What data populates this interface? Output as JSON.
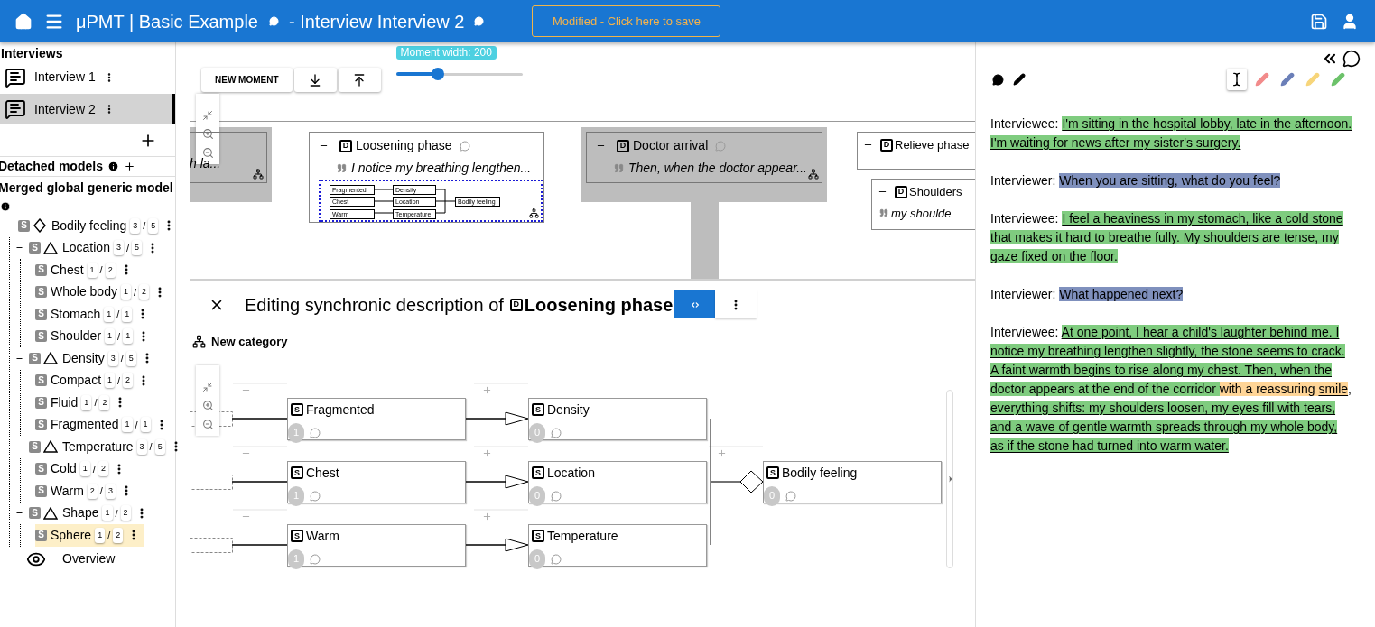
{
  "header": {
    "title": "μPMT | Basic Example",
    "interview_title": "- Interview Interview 2",
    "save_button": "Modified - Click here to save"
  },
  "sidebar": {
    "interviews_heading": "Interviews",
    "interviews": [
      {
        "label": "Interview 1",
        "selected": false
      },
      {
        "label": "Interview 2",
        "selected": true
      }
    ],
    "detached_heading": "Detached models",
    "merged_heading": "Merged global generic model",
    "tree": [
      {
        "badge": "S",
        "kind": "generic",
        "label": "Bodily feeling",
        "counts": [
          "3",
          "/",
          "5"
        ],
        "selected": false,
        "expanded": true,
        "children": [
          {
            "badge": "S",
            "kind": "category",
            "label": "Location",
            "counts": [
              "3",
              "/",
              "5"
            ],
            "selected": false,
            "expanded": true,
            "children": [
              {
                "badge": "S",
                "label": "Chest",
                "counts": [
                  "1",
                  "/",
                  "2"
                ],
                "selected": false
              },
              {
                "badge": "S",
                "label": "Whole body",
                "counts": [
                  "1",
                  "/",
                  "2"
                ],
                "selected": false
              },
              {
                "badge": "S",
                "label": "Stomach",
                "counts": [
                  "1",
                  "/",
                  "1"
                ],
                "selected": false
              },
              {
                "badge": "S",
                "label": "Shoulder",
                "counts": [
                  "1",
                  "/",
                  "1"
                ],
                "selected": false
              }
            ]
          },
          {
            "badge": "S",
            "kind": "category",
            "label": "Density",
            "counts": [
              "3",
              "/",
              "5"
            ],
            "selected": false,
            "expanded": true,
            "children": [
              {
                "badge": "S",
                "label": "Compact",
                "counts": [
                  "1",
                  "/",
                  "2"
                ],
                "selected": false
              },
              {
                "badge": "S",
                "label": "Fluid",
                "counts": [
                  "1",
                  "/",
                  "2"
                ],
                "selected": false
              },
              {
                "badge": "S",
                "label": "Fragmented",
                "counts": [
                  "1",
                  "/",
                  "1"
                ],
                "selected": false
              }
            ]
          },
          {
            "badge": "S",
            "kind": "category",
            "label": "Temperature",
            "counts": [
              "3",
              "/",
              "5"
            ],
            "selected": false,
            "expanded": true,
            "children": [
              {
                "badge": "S",
                "label": "Cold",
                "counts": [
                  "1",
                  "/",
                  "2"
                ],
                "selected": false
              },
              {
                "badge": "S",
                "label": "Warm",
                "counts": [
                  "2",
                  "/",
                  "3"
                ],
                "selected": false
              }
            ]
          },
          {
            "badge": "S",
            "kind": "category",
            "label": "Shape",
            "counts": [
              "1",
              "/",
              "2"
            ],
            "selected": false,
            "expanded": true,
            "children": [
              {
                "badge": "S",
                "label": "Sphere",
                "counts": [
                  "1",
                  "/",
                  "2"
                ],
                "selected": true
              }
            ]
          }
        ]
      }
    ],
    "overview": "Overview"
  },
  "toolbar": {
    "new_moment": "NEW MOMENT",
    "slider": {
      "label": "Moment width: 200",
      "level": 0.33
    }
  },
  "moments": [
    {
      "kind": "partial",
      "quote": "h la...",
      "highlighted": true
    },
    {
      "kind": "card",
      "badge": "D",
      "title": "Loosening phase",
      "quote": "I notice my breathing lengthen...",
      "highlighted": false,
      "mini_diagram": [
        [
          "Fragmented",
          "Chest",
          "Warm"
        ],
        [
          "Density",
          "Location",
          "Temperature"
        ],
        [
          "Bodily feeling"
        ]
      ]
    },
    {
      "kind": "card",
      "badge": "D",
      "title": "Doctor arrival",
      "quote": "Then, when the doctor appear...",
      "highlighted": true
    },
    {
      "kind": "nested",
      "badge": "D",
      "title": "Relieve phase",
      "highlighted": false,
      "children": [
        {
          "badge": "D",
          "title": "Shoulders",
          "quote": "my shoulde"
        }
      ]
    }
  ],
  "editor": {
    "title": "Editing synchronic description of",
    "badge": "D",
    "moment": "Loosening phase",
    "new_category": "New category",
    "columns": [
      {
        "kind": "source",
        "nodes": [
          {
            "badge": "S",
            "label": "Fragmented",
            "count": "1"
          },
          {
            "badge": "S",
            "label": "Chest",
            "count": "1"
          },
          {
            "badge": "S",
            "label": "Warm",
            "count": "1"
          }
        ]
      },
      {
        "kind": "specialization",
        "nodes": [
          {
            "badge": "S",
            "label": "Density",
            "count": "0"
          },
          {
            "badge": "S",
            "label": "Location",
            "count": "0"
          },
          {
            "badge": "S",
            "label": "Temperature",
            "count": "0"
          }
        ]
      },
      {
        "kind": "aggregation",
        "nodes": [
          {
            "badge": "S",
            "label": "Bodily feeling",
            "count": "0"
          }
        ]
      }
    ]
  },
  "highlight_tools": [
    {
      "kind": "cursor",
      "selected": true
    },
    {
      "kind": "pencil",
      "color": "#f28b8b",
      "selected": false
    },
    {
      "kind": "pencil",
      "color": "#6b7fb8",
      "selected": false
    },
    {
      "kind": "pencil",
      "color": "#f7d57a",
      "selected": false
    },
    {
      "kind": "pencil",
      "color": "#6cc26a",
      "selected": false
    }
  ],
  "transcript": [
    {
      "speaker": "Interviewee:",
      "segments": [
        {
          "text": "I'm sitting in the hospital lobby, late in the afternoon. I'm waiting for news after my sister's surgery.",
          "color": "#7fcc7f",
          "underline": true
        }
      ]
    },
    {
      "speaker": "Interviewer:",
      "segments": [
        {
          "text": "When you are sitting, what do you feel?",
          "color": "#7f90bd",
          "underline": false
        }
      ]
    },
    {
      "speaker": "Interviewee:",
      "segments": [
        {
          "text": "I feel a heaviness in my stomach, like a cold stone that makes it hard to breathe fully. My shoulders are tense, my gaze fixed on the floor.",
          "color": "#7fcc7f",
          "underline": true
        }
      ]
    },
    {
      "speaker": "Interviewer:",
      "segments": [
        {
          "text": "What happened next?",
          "color": "#7f90bd",
          "underline": false
        }
      ]
    },
    {
      "speaker": "Interviewee:",
      "segments": [
        {
          "text": "At one point, I hear a child's laughter behind me. I notice my breathing lengthen slightly, the stone seems to crack. A faint warmth begins to rise along my chest. Then, when the ",
          "color": "#7fcc7f",
          "underline": true
        },
        {
          "text": "doctor appears at the end of the corridor ",
          "color": "#7fcc7f",
          "underline": false
        },
        {
          "text": "with a reassuring ",
          "color": "#ffd597",
          "underline": false
        },
        {
          "text": "smile",
          "color": "#ffd597",
          "underline": true
        },
        {
          "text": ", ",
          "underline": false
        },
        {
          "text": "everything shifts: my shoulders loosen, my eyes fill with tears, and a wave of gentle warmth spreads through my whole body, as if the stone had turned into warm water.",
          "color": "#7fcc7f",
          "underline": true
        }
      ]
    }
  ]
}
